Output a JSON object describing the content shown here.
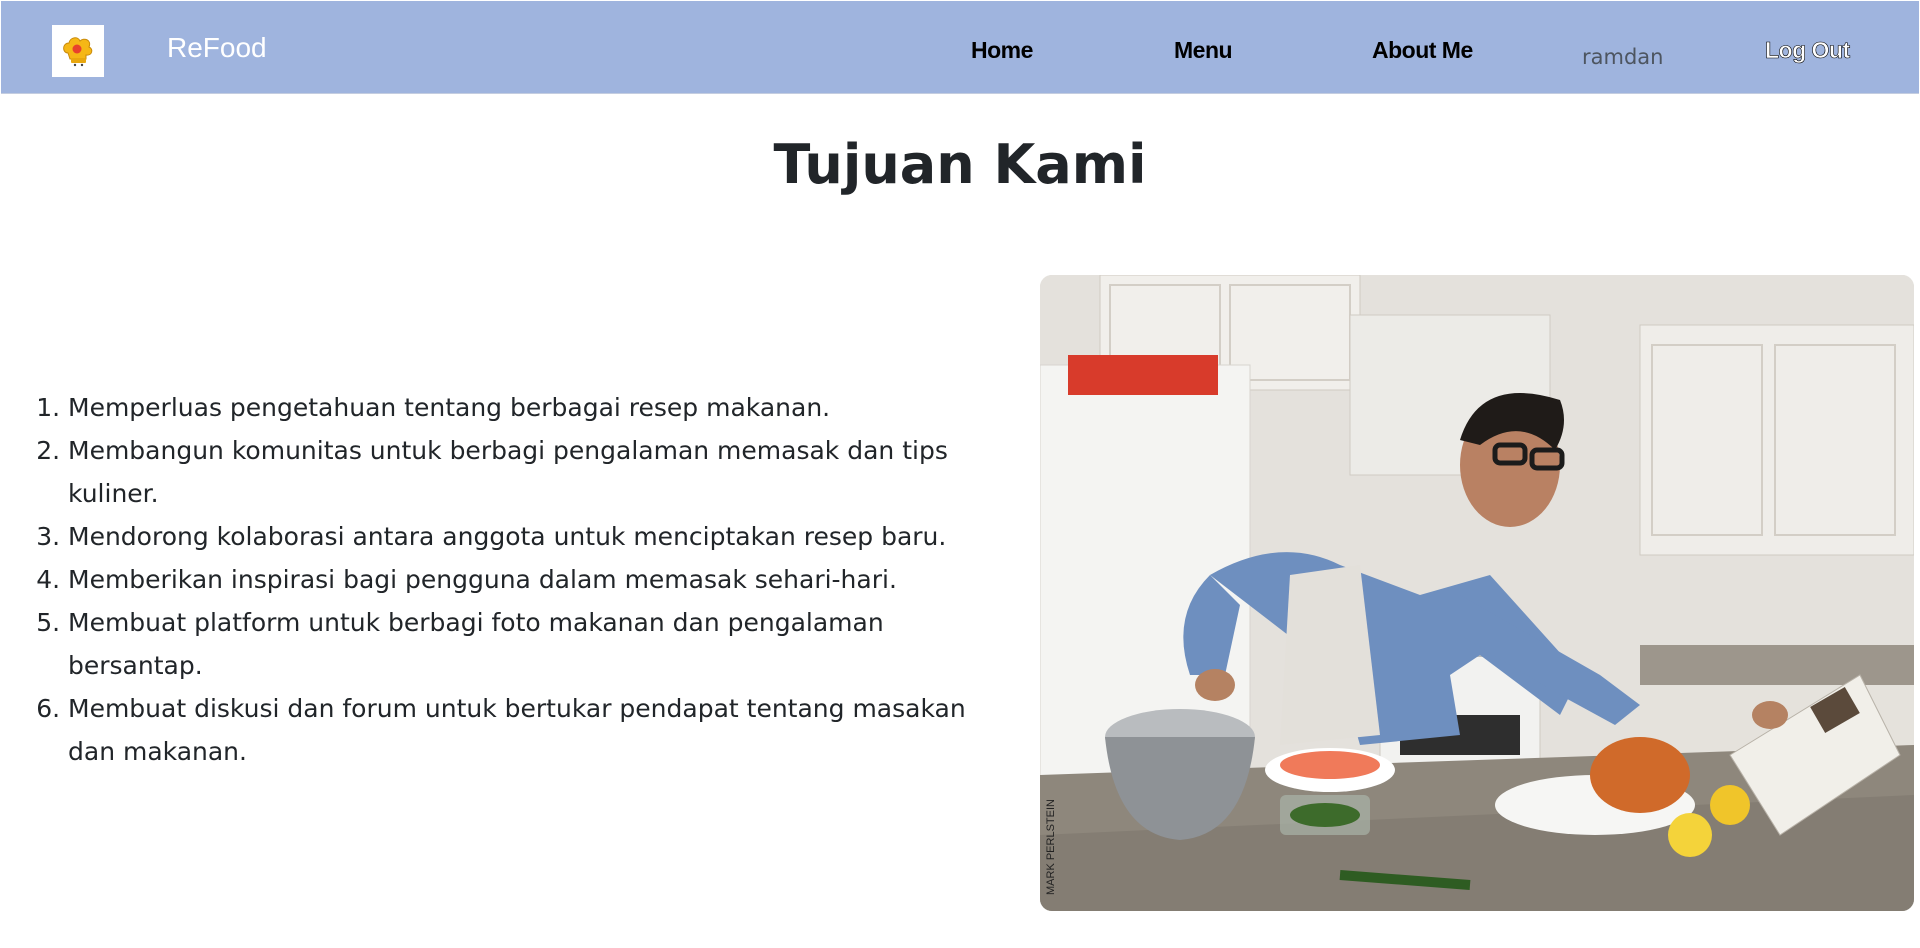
{
  "navbar": {
    "brand_name": "ReFood",
    "links": [
      {
        "label": "Home"
      },
      {
        "label": "Menu"
      },
      {
        "label": "About Me"
      }
    ],
    "username": "ramdan",
    "logout_label": "Log Out",
    "colors": {
      "background": "#9fb4de",
      "brand_text": "#ffffff",
      "link_text": "#000000"
    }
  },
  "main": {
    "title": "Tujuan Kami",
    "goals": [
      "Memperluas pengetahuan tentang berbagai resep makanan.",
      "Membangun komunitas untuk berbagi pengalaman memasak dan tips kuliner.",
      "Mendorong kolaborasi antara anggota untuk menciptakan resep baru.",
      "Memberikan inspirasi bagi pengguna dalam memasak sehari-hari.",
      "Membuat platform untuk berbagi foto makanan dan pengalaman bersantap.",
      "Membuat diskusi dan forum untuk bertukar pendapat tentang masakan dan makanan."
    ],
    "image": {
      "caption_credit": "MARK PERLSTEIN"
    }
  }
}
